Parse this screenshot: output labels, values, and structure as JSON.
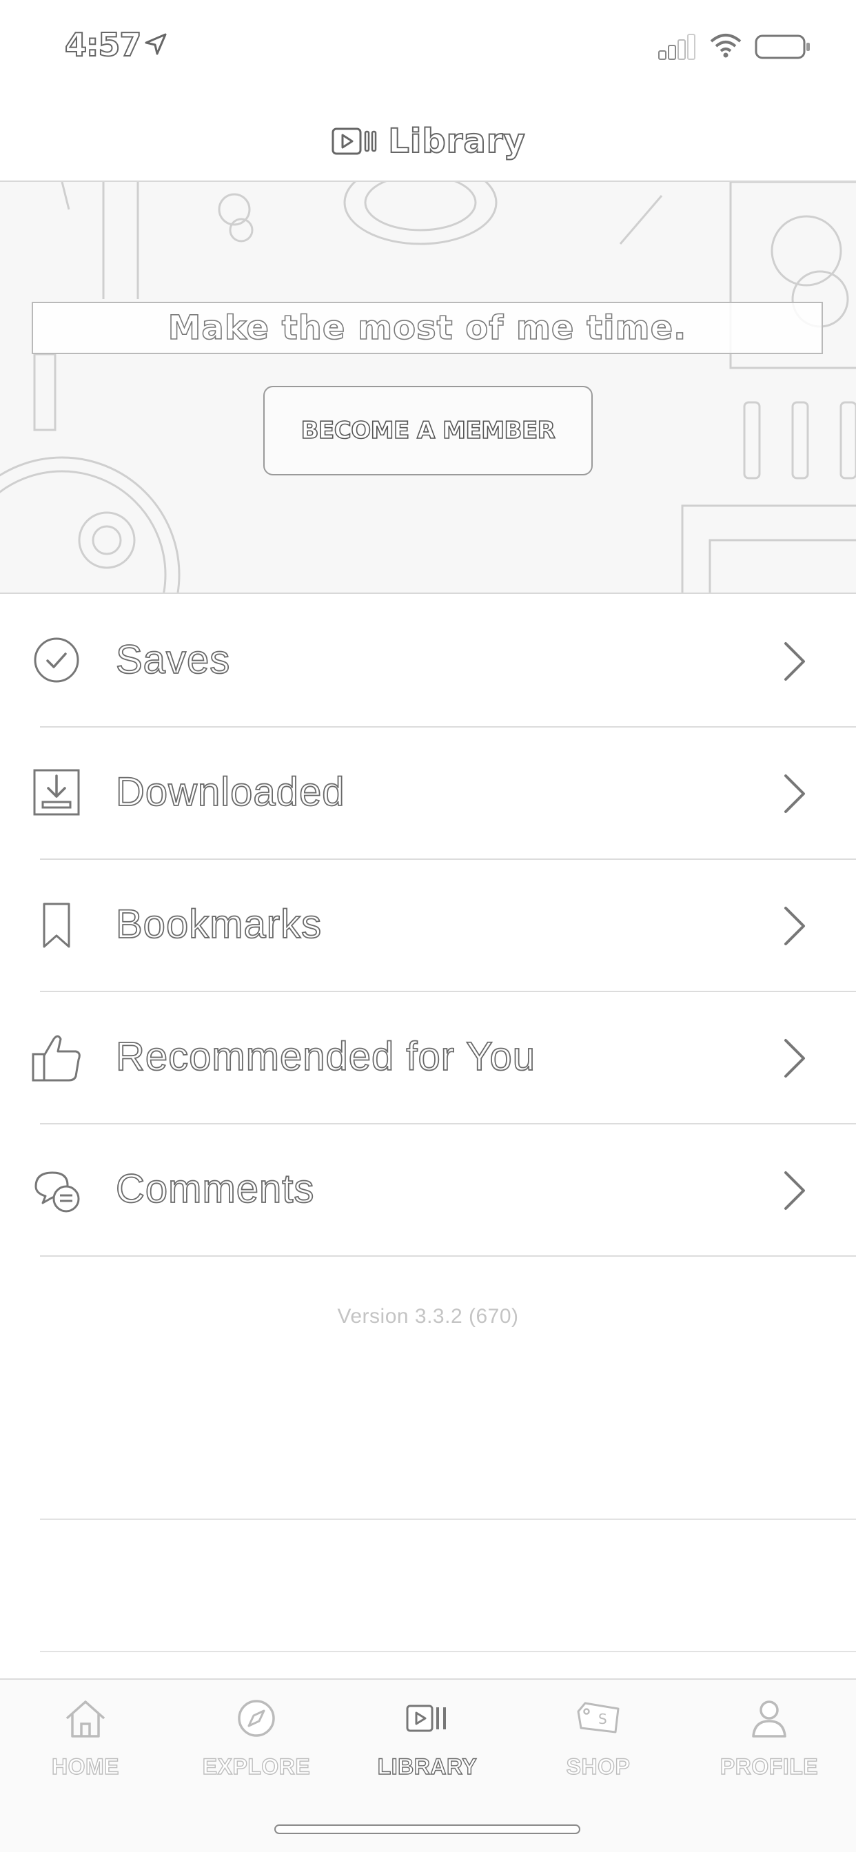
{
  "status_bar": {
    "time": "4:57",
    "icons": [
      "location-arrow-icon",
      "cellular-signal-icon",
      "wifi-icon",
      "battery-icon"
    ]
  },
  "header": {
    "icon": "library-icon",
    "title": "Library"
  },
  "banner": {
    "tagline": "Make the most of me time.",
    "cta_label": "BECOME A MEMBER"
  },
  "menu": {
    "items": [
      {
        "label": "Saves",
        "icon": "check-circle-icon"
      },
      {
        "label": "Downloaded",
        "icon": "download-icon"
      },
      {
        "label": "Bookmarks",
        "icon": "bookmark-icon"
      },
      {
        "label": "Recommended for You",
        "icon": "thumbs-up-icon"
      },
      {
        "label": "Comments",
        "icon": "comments-icon"
      }
    ]
  },
  "version": "Version 3.3.2  (670)",
  "tab_bar": {
    "active": "LIBRARY",
    "tabs": [
      {
        "label": "HOME",
        "icon": "home-icon"
      },
      {
        "label": "EXPLORE",
        "icon": "compass-icon"
      },
      {
        "label": "LIBRARY",
        "icon": "library-icon"
      },
      {
        "label": "SHOP",
        "icon": "shop-tag-icon"
      },
      {
        "label": "PROFILE",
        "icon": "profile-icon"
      }
    ]
  }
}
